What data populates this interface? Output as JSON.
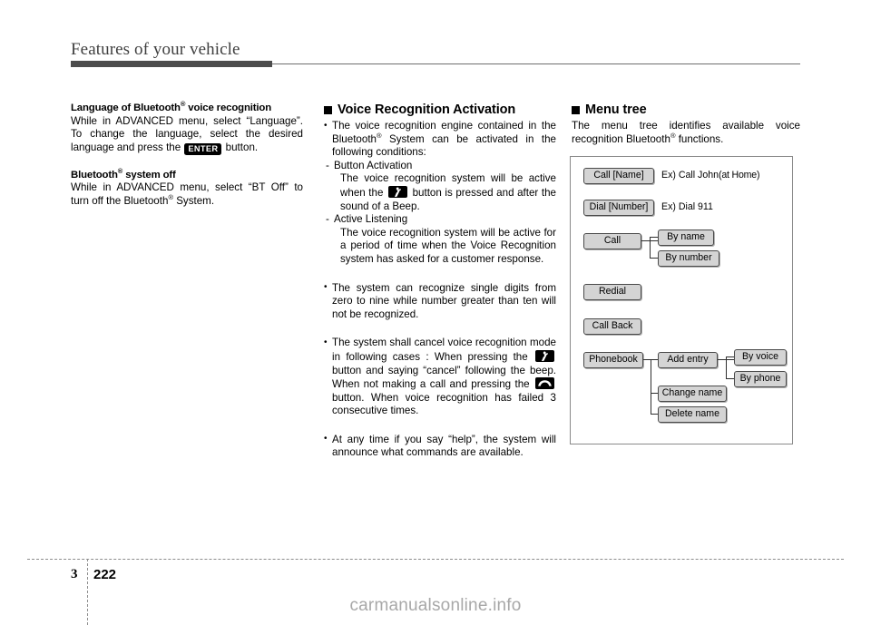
{
  "header": {
    "title": "Features of your vehicle"
  },
  "left_column": {
    "heading1": "Language of Bluetooth",
    "heading1_sup": "®",
    "heading1_rest": " voice recognition",
    "para1_a": "While in ADVANCED menu, select “Language”. To change the language, select the desired language and press the ",
    "para1_key": "ENTER",
    "para1_b": " button.",
    "heading2": "Bluetooth",
    "heading2_sup": "®",
    "heading2_rest": " system off",
    "para2_a": "While in ADVANCED menu, select “BT Off”  to turn off the Bluetooth",
    "para2_sup": "®",
    "para2_b": " System."
  },
  "middle_column": {
    "section_title": "Voice Recognition Activation",
    "bullet1_a": "The voice recognition engine contained in the Bluetooth",
    "bullet1_sup": "®",
    "bullet1_b": " System can be activated in the following conditions:",
    "sub1_label": "Button Activation",
    "sub1_text_a": "The voice recognition system will be active when the ",
    "sub1_icon": "voice-recognition-button-icon",
    "sub1_text_b": " button is pressed and after the sound of a Beep.",
    "sub2_label": "Active Listening",
    "sub2_text": "The voice recognition system will be active for a period of time when the Voice Recognition system has asked for a customer response.",
    "bullet2": "The system can recognize single digits from zero to nine while number greater than ten will not be recognized.",
    "bullet3_a": "The system shall cancel voice recognition mode in following cases : When pressing the ",
    "bullet3_icon1": "voice-recognition-button-icon",
    "bullet3_b": " button and saying “cancel” following the beep. When not making a call and pressing the ",
    "bullet3_icon2": "end-call-button-icon",
    "bullet3_c": " button. When voice recognition has failed 3 consecutive times.",
    "bullet4": "At any time if you say “help”, the system will announce what commands are available."
  },
  "right_column": {
    "section_title": "Menu tree",
    "intro_a": "The menu tree identifies available voice recognition Bluetooth",
    "intro_sup": "®",
    "intro_b": " functions."
  },
  "menu_tree": {
    "nodes": [
      {
        "id": "call-name",
        "label": "Call [Name]"
      },
      {
        "id": "dial-number",
        "label": "Dial [Number]"
      },
      {
        "id": "call",
        "label": "Call"
      },
      {
        "id": "by-name",
        "label": "By name"
      },
      {
        "id": "by-number",
        "label": "By number"
      },
      {
        "id": "redial",
        "label": "Redial"
      },
      {
        "id": "call-back",
        "label": "Call Back"
      },
      {
        "id": "phonebook",
        "label": "Phonebook"
      },
      {
        "id": "add-entry",
        "label": "Add entry"
      },
      {
        "id": "by-voice",
        "label": "By voice"
      },
      {
        "id": "by-phone",
        "label": "By phone"
      },
      {
        "id": "change-name",
        "label": "Change name"
      },
      {
        "id": "delete-name",
        "label": "Delete name"
      }
    ],
    "examples": [
      {
        "id": "ex-call-name",
        "prefix": "Ex) Call John",
        "suffix": "(at Home)"
      },
      {
        "id": "ex-dial-number",
        "prefix": "Ex) Dial 911",
        "suffix": ""
      }
    ]
  },
  "footer": {
    "chapter": "3",
    "page": "222",
    "watermark": "carmanualsonline.info"
  },
  "colors": {
    "header_rule": "#4c4c4c",
    "node_fill": "#d4d4d4",
    "node_border": "#4a4a4a",
    "panel_border": "#8a8a8a",
    "watermark": "#a8a8a8"
  }
}
